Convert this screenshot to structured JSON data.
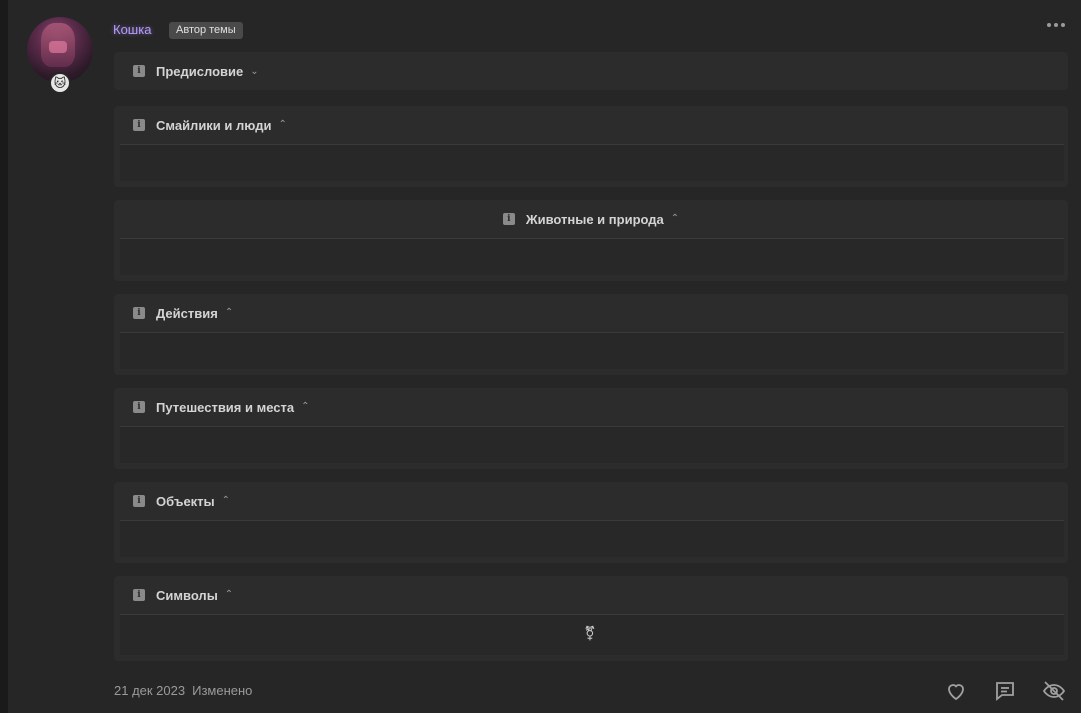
{
  "post": {
    "username": "Кошка",
    "author_badge": "Автор темы",
    "avatar_badge_glyph": "🐱",
    "more_menu_icon": "ellipsis-horizontal-icon"
  },
  "spoilers": [
    {
      "title": "Предисловие",
      "state": "collapsed",
      "chevron": "⌄"
    },
    {
      "title": "Смайлики и люди",
      "state": "expanded",
      "chevron": "⌃"
    },
    {
      "title": "Животные и природа",
      "state": "expanded",
      "chevron": "⌃"
    },
    {
      "title": "Действия",
      "state": "expanded",
      "chevron": "⌃"
    },
    {
      "title": "Путешествия и места",
      "state": "expanded",
      "chevron": "⌃"
    },
    {
      "title": "Объекты",
      "state": "expanded",
      "chevron": "⌃"
    },
    {
      "title": "Символы",
      "state": "expanded",
      "chevron": "⌃",
      "content": "⚧"
    }
  ],
  "footer": {
    "date": "21 дек 2023",
    "edited": "Изменено",
    "actions": [
      "heart-icon",
      "reply-comment-icon",
      "hide-eye-slash-icon"
    ]
  },
  "colors": {
    "background": "#202020",
    "panel": "#262626",
    "spoiler_bg": "#2c2c2c",
    "username": "#b59cf5",
    "badge_bg": "#4a4a4a",
    "muted_text": "#9a9a9a"
  }
}
